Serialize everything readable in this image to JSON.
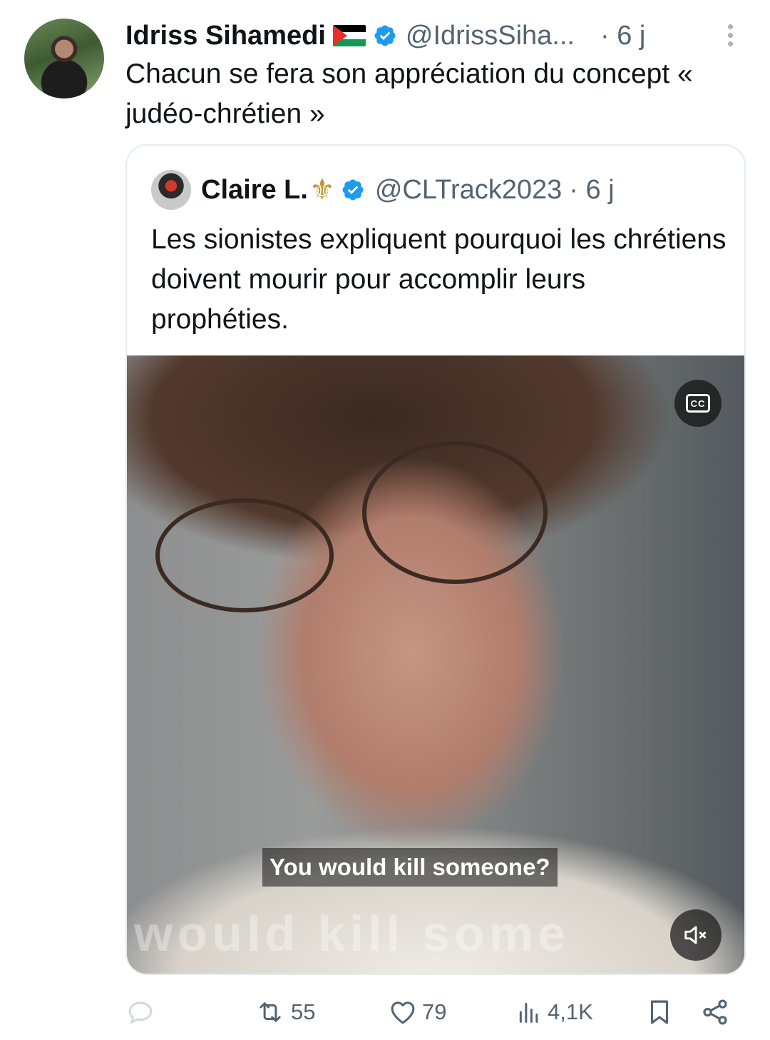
{
  "tweet": {
    "author_name": "Idriss Sihamedi",
    "handle": "@IdrissSiha...",
    "time": "· 6 j",
    "text": "Chacun se fera son appréciation du concept « judéo-chrétien »"
  },
  "quote": {
    "author_name": "Claire L.",
    "handle": "@CLTrack2023",
    "time": "· 6 j",
    "text": "Les sionistes expliquent pourquoi les chrétiens doivent mourir pour accomplir leurs prophéties.",
    "video": {
      "cc_label": "CC",
      "subtitle": "You would kill someone?",
      "background_caption": "would kill some"
    }
  },
  "actions": {
    "retweets": "55",
    "likes": "79",
    "views": "4,1K"
  },
  "colors": {
    "verified": "#1d9bf0",
    "muted_text": "#536471",
    "fleur": "#c4952f"
  },
  "icons": [
    "more-icon",
    "verified-icon",
    "flag-icon",
    "fleur-de-lis-icon",
    "cc-icon",
    "mute-icon",
    "reply-icon",
    "retweet-icon",
    "like-icon",
    "views-icon",
    "bookmark-icon",
    "share-icon"
  ]
}
